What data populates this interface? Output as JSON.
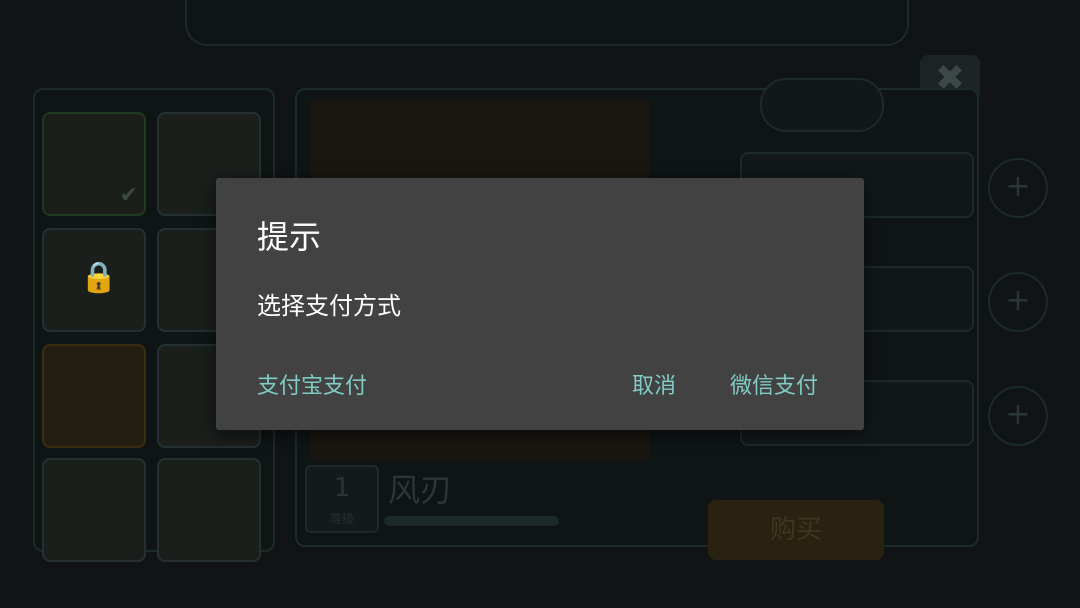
{
  "background": {
    "skill_level": "1",
    "skill_level_label": "等级",
    "skill_name": "风刃",
    "buy_label": "购买",
    "close_glyph": "✖"
  },
  "dialog": {
    "title": "提示",
    "message": "选择支付方式",
    "buttons": {
      "alipay": "支付宝支付",
      "cancel": "取消",
      "wechat": "微信支付"
    }
  },
  "colors": {
    "dialog_bg": "#424242",
    "accent": "#80cbc4",
    "text": "#ffffff"
  }
}
